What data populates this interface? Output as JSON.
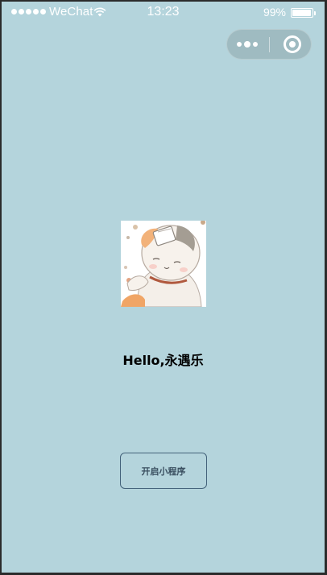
{
  "status_bar": {
    "carrier": "WeChat",
    "time": "13:23",
    "battery_percent": "99%",
    "battery_level": 0.99,
    "signal_bars": 5
  },
  "capsule": {
    "more_icon": "more-dots-icon",
    "close_icon": "target-circle-icon"
  },
  "avatar": {
    "description_icon": "cat-avatar-image"
  },
  "greeting": "Hello,永遇乐",
  "open_button_label": "开启小程序",
  "colors": {
    "background": "#b4d4dc",
    "button_border": "#43627a",
    "capsule": "#9fbbc1"
  }
}
